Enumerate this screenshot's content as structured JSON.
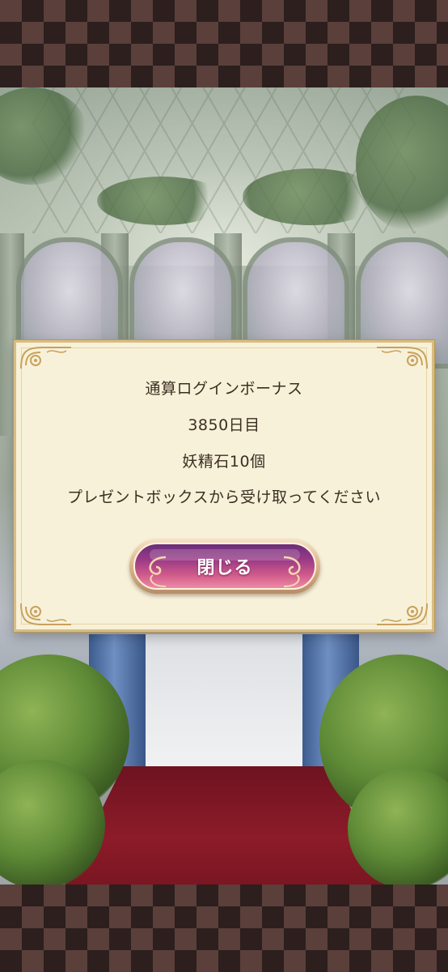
{
  "dialog": {
    "title": "通算ログインボーナス",
    "day_count": "3850日目",
    "reward": "妖精石10個",
    "instruction": "プレゼントボックスから受け取ってください",
    "close_label": "閉じる"
  },
  "colors": {
    "dialog_bg": "#f7f1d9",
    "dialog_border": "#d8bd84",
    "button_top": "#6b2d7a",
    "button_bottom": "#f08aa6",
    "band_light": "#5a3f3b",
    "band_dark": "#2c1f1e"
  }
}
